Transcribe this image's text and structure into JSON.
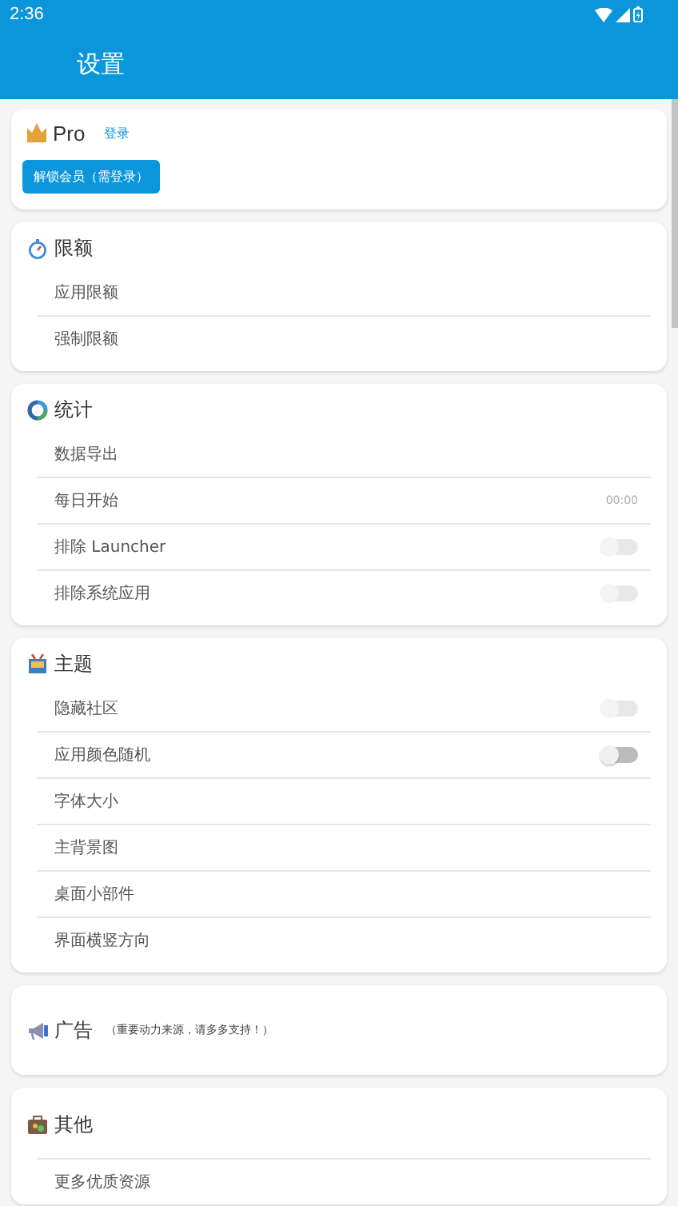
{
  "status_bar": {
    "time": "2:36"
  },
  "app_bar": {
    "title": "设置"
  },
  "pro": {
    "title": "Pro",
    "login_link": "登录",
    "unlock_button": "解锁会员（需登录）"
  },
  "sections": [
    {
      "kind": "limit",
      "title": "限额",
      "rows": [
        {
          "kind": "plain",
          "label": "应用限额"
        },
        {
          "kind": "plain",
          "label": "强制限额"
        }
      ]
    },
    {
      "kind": "stats",
      "title": "统计",
      "rows": [
        {
          "kind": "plain",
          "label": "数据导出"
        },
        {
          "kind": "value",
          "label": "每日开始",
          "value": "00:00"
        },
        {
          "kind": "toggle",
          "label": "排除 Launcher",
          "on": false,
          "disabled": true
        },
        {
          "kind": "toggle",
          "label": "排除系统应用",
          "on": false,
          "disabled": true
        }
      ]
    },
    {
      "kind": "theme",
      "title": "主题",
      "rows": [
        {
          "kind": "toggle",
          "label": "隐藏社区",
          "on": false,
          "disabled": true
        },
        {
          "kind": "toggle",
          "label": "应用颜色随机",
          "on": false,
          "disabled": false
        },
        {
          "kind": "plain",
          "label": "字体大小"
        },
        {
          "kind": "plain",
          "label": "主背景图"
        },
        {
          "kind": "plain",
          "label": "桌面小部件"
        },
        {
          "kind": "plain",
          "label": "界面横竖方向"
        }
      ]
    },
    {
      "kind": "ad",
      "title": "广告",
      "note": "（重要动力来源，请多多支持！）"
    },
    {
      "kind": "other",
      "title": "其他",
      "rows": [
        {
          "kind": "plain",
          "label": "更多优质资源"
        }
      ]
    }
  ]
}
